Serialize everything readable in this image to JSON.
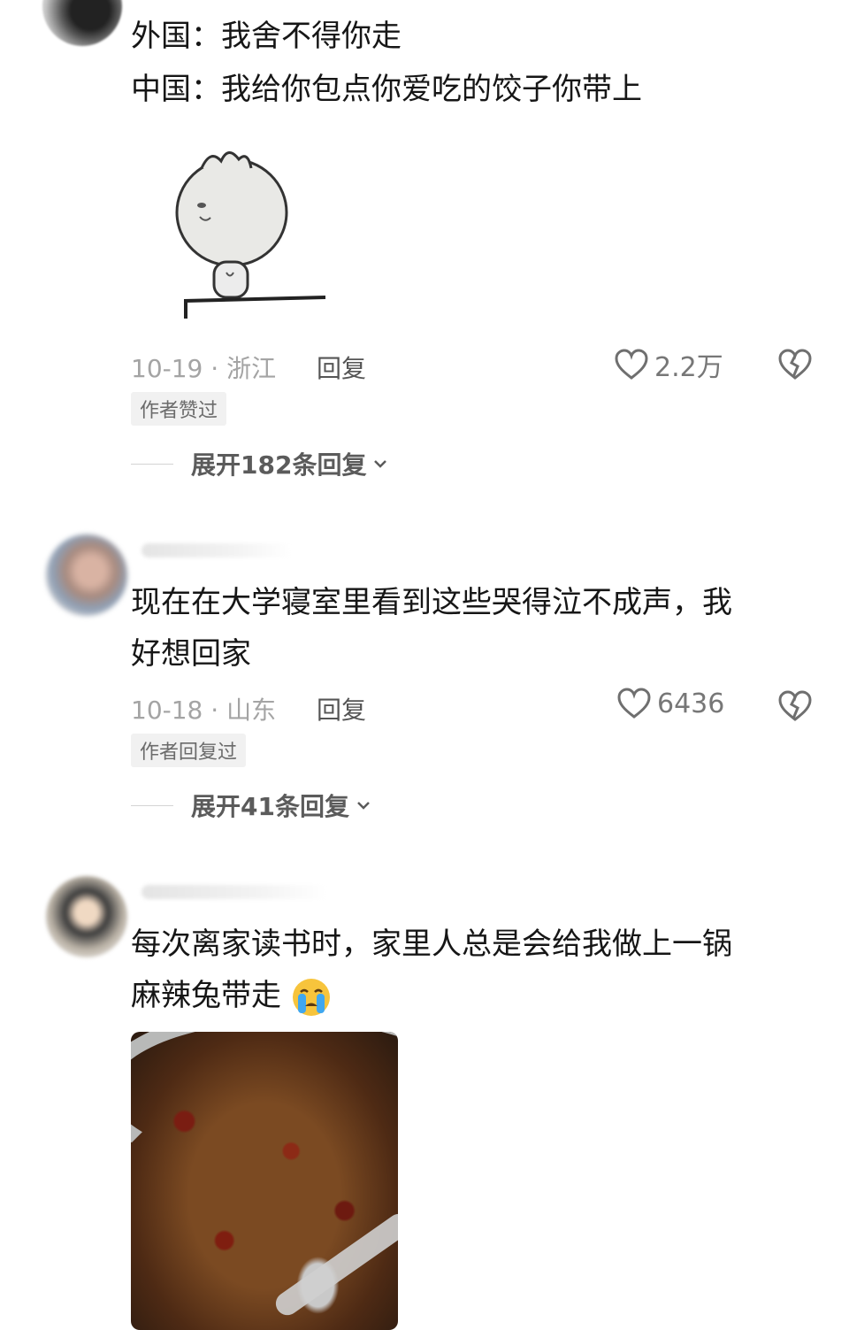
{
  "comments": [
    {
      "lines": [
        "外国：我舍不得你走",
        "中国：我给你包点你爱吃的饺子你带上"
      ],
      "date": "10-19",
      "location": "浙江",
      "reply_label": "回复",
      "likes": "2.2万",
      "tag": "作者赞过",
      "expand": "展开182条回复"
    },
    {
      "lines": [
        "现在在大学寝室里看到这些哭得泣不成声，我",
        "好想回家"
      ],
      "date": "10-18",
      "location": "山东",
      "reply_label": "回复",
      "likes": "6436",
      "tag": "作者回复过",
      "expand": "展开41条回复"
    },
    {
      "lines": [
        "每次离家读书时，家里人总是会给我做上一锅",
        "麻辣兔带走"
      ]
    }
  ],
  "icons": {
    "like": "heart-outline-icon",
    "dislike": "broken-heart-icon",
    "expand": "chevron-down-icon",
    "emoji": "crying-face-emoji"
  }
}
